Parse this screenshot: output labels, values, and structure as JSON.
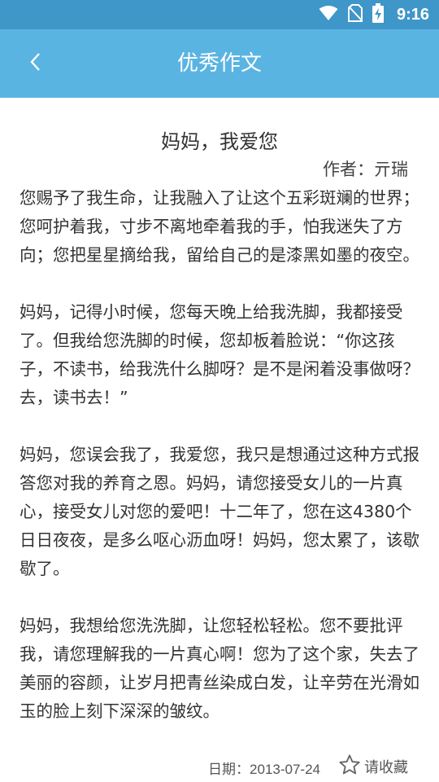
{
  "status_bar": {
    "time": "9:16",
    "icons": [
      "wifi-icon",
      "no-sim-icon",
      "battery-charging-icon"
    ]
  },
  "app_bar": {
    "back_icon": "chevron-left-icon",
    "title": "优秀作文"
  },
  "article": {
    "title": "妈妈，我爱您",
    "author": "作者：亓瑞",
    "paragraphs": [
      "您赐予了我生命，让我融入了让这个五彩斑斓的世界；您呵护着我，寸步不离地牵着我的手，怕我迷失了方向；您把星星摘给我，留给自己的是漆黑如墨的夜空。",
      "妈妈，记得小时候，您每天晚上给我洗脚，我都接受了。但我给您洗脚的时候，您却板着脸说：“你这孩子，不读书，给我洗什么脚呀？是不是闲着没事做呀？去，读书去！”",
      "妈妈，您误会我了，我爱您，我只是想通过这种方式报答您对我的养育之恩。妈妈，请您接受女儿的一片真心，接受女儿对您的爱吧！十二年了，您在这4380个日日夜夜，是多么呕心沥血呀！妈妈，您太累了，该歇歇了。",
      "妈妈，我想给您洗洗脚，让您轻松轻松。您不要批评我，请您理解我的一片真心啊！您为了这个家，失去了美丽的容颜，让岁月把青丝染成白发，让辛劳在光滑如玉的脸上刻下深深的皱纹。"
    ],
    "date": "日期：2013-07-24",
    "favorite_label": "请收藏",
    "favorite_icon": "star-outline-icon"
  },
  "colors": {
    "status_bar": "#3f96c8",
    "app_bar": "#5ab4e2",
    "text": "#333333"
  }
}
